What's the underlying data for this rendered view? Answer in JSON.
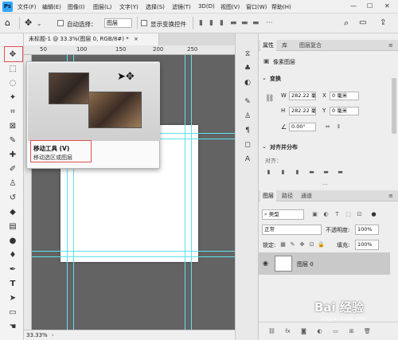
{
  "menubar": {
    "logo": "Ps",
    "items": [
      "文件(F)",
      "编辑(E)",
      "图像(I)",
      "图层(L)",
      "文字(Y)",
      "选择(S)",
      "滤镜(T)",
      "3D(D)",
      "视图(V)",
      "窗口(W)",
      "帮助(H)"
    ],
    "window_controls": [
      "—",
      "☐",
      "✕"
    ]
  },
  "options": {
    "auto_select_label": "自动选择：",
    "auto_select_value": "图层",
    "show_transform_label": "显示变换控件"
  },
  "document": {
    "tab_title": "未标题-1 @ 33.3%(图层 0, RGB/8#) *",
    "ruler_ticks": [
      "50",
      "100",
      "150",
      "200",
      "250"
    ],
    "zoom": "33.33%"
  },
  "tooltip": {
    "title": "移动工具 (V)",
    "description": "移动选区或图层"
  },
  "properties_panel": {
    "tabs": [
      "属性",
      "库",
      "图层复合"
    ],
    "subtitle": "像素图层",
    "transform_label": "变换",
    "w_label": "W",
    "h_label": "H",
    "x_label": "X",
    "y_label": "Y",
    "w_value": "282.22 毫",
    "h_value": "282.22 毫",
    "x_value": "0 毫米",
    "y_value": "0 毫米",
    "angle_value": "0.00°",
    "align_label": "对齐并分布",
    "align_sub": "对齐："
  },
  "layers_panel": {
    "tabs": [
      "图层",
      "路径",
      "通道"
    ],
    "filter_label": "类型",
    "blend_mode": "正常",
    "opacity_label": "不透明度:",
    "opacity_value": "100%",
    "lock_label": "锁定:",
    "fill_label": "填充:",
    "fill_value": "100%",
    "layer_name": "图层 0"
  },
  "watermark": {
    "text": "Bai 经验",
    "sub": "jingyan.baidu.com"
  }
}
